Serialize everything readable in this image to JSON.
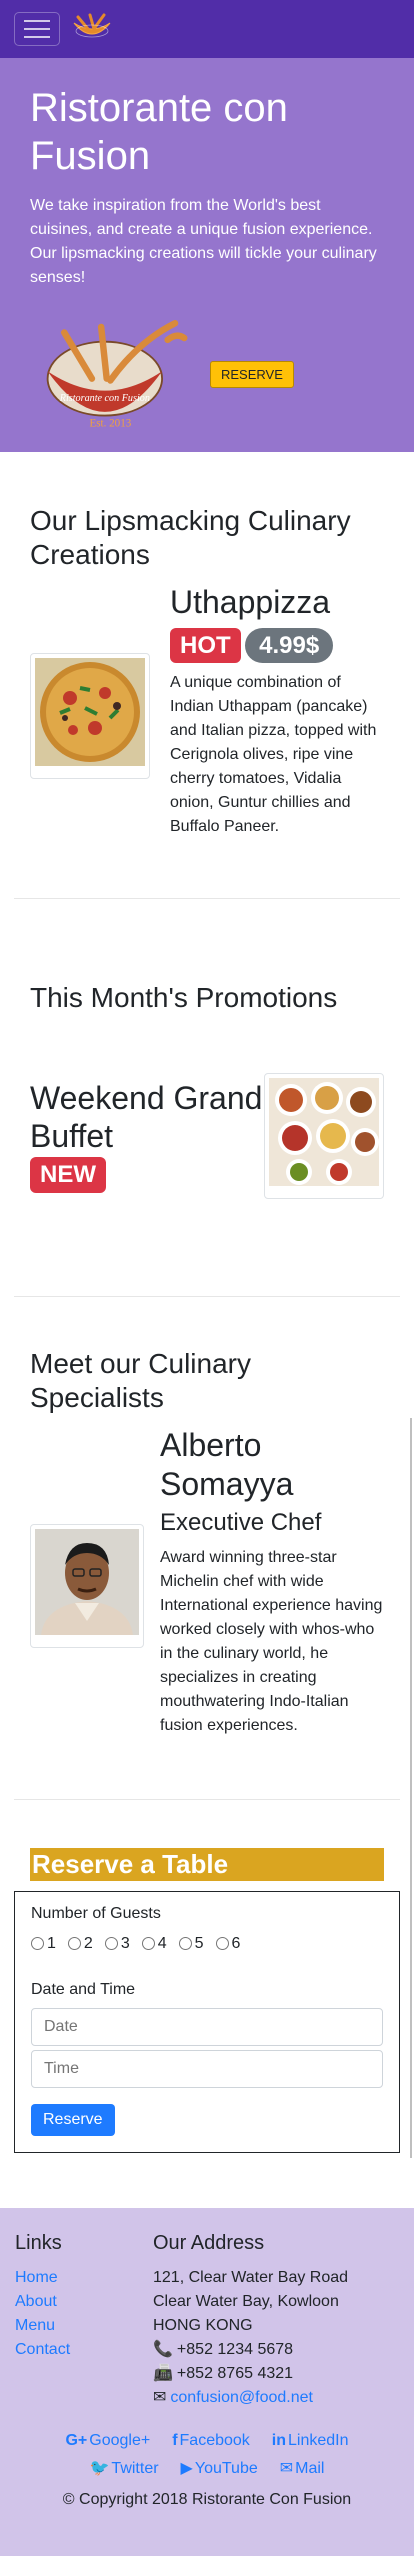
{
  "navbar": {
    "menu_icon": "hamburger-icon",
    "logo_icon": "restaurant-logo-icon"
  },
  "jumbotron": {
    "title": "Ristorante con Fusion",
    "tagline": "We take inspiration from the World's best cuisines, and create a unique fusion experience. Our lipsmacking creations will tickle your culinary senses!",
    "logo_text": "Ristorante con Fusion",
    "logo_est": "Est. 2013",
    "reserve_button": "RESERVE"
  },
  "dish": {
    "section_title": "Our Lipsmacking Culinary Creations",
    "name": "Uthappizza",
    "badge": "HOT",
    "price": "4.99$",
    "description": "A unique combination of Indian Uthappam (pancake) and Italian pizza, topped with Cerignola olives, ripe vine cherry tomatoes, Vidalia onion, Guntur chillies and Buffalo Paneer."
  },
  "promotion": {
    "section_title": "This Month's Promotions",
    "name": "Weekend Grand Buffet",
    "badge": "NEW"
  },
  "leader": {
    "section_title": "Meet our Culinary Specialists",
    "name": "Alberto Somayya",
    "designation": "Executive Chef",
    "description": "Award winning three-star Michelin chef with wide International experience having worked closely with whos-who in the culinary world, he specializes in creating mouthwatering Indo-Italian fusion experiences."
  },
  "reservation": {
    "title": "Reserve a Table",
    "guests_label": "Number of Guests",
    "guest_options": [
      "1",
      "2",
      "3",
      "4",
      "5",
      "6"
    ],
    "datetime_label": "Date and Time",
    "date_placeholder": "Date",
    "time_placeholder": "Time",
    "submit_label": "Reserve"
  },
  "footer": {
    "links_title": "Links",
    "links": [
      "Home",
      "About",
      "Menu",
      "Contact"
    ],
    "address_title": "Our Address",
    "address_lines": [
      "121, Clear Water Bay Road",
      "Clear Water Bay, Kowloon",
      "HONG KONG"
    ],
    "phone": "+852 1234 5678",
    "fax": "+852 8765 4321",
    "email": "confusion@food.net",
    "social": {
      "google": "Google+",
      "facebook": "Facebook",
      "linkedin": "LinkedIn",
      "twitter": "Twitter",
      "youtube": "YouTube",
      "mail": "Mail"
    },
    "copyright": "© Copyright 2018 Ristorante Con Fusion"
  },
  "colors": {
    "navbar": "#512DA8",
    "jumbotron": "#9575CD",
    "footer": "#D1C4E9",
    "reserve_heading": "#DAA520",
    "link": "#1e7bff"
  }
}
